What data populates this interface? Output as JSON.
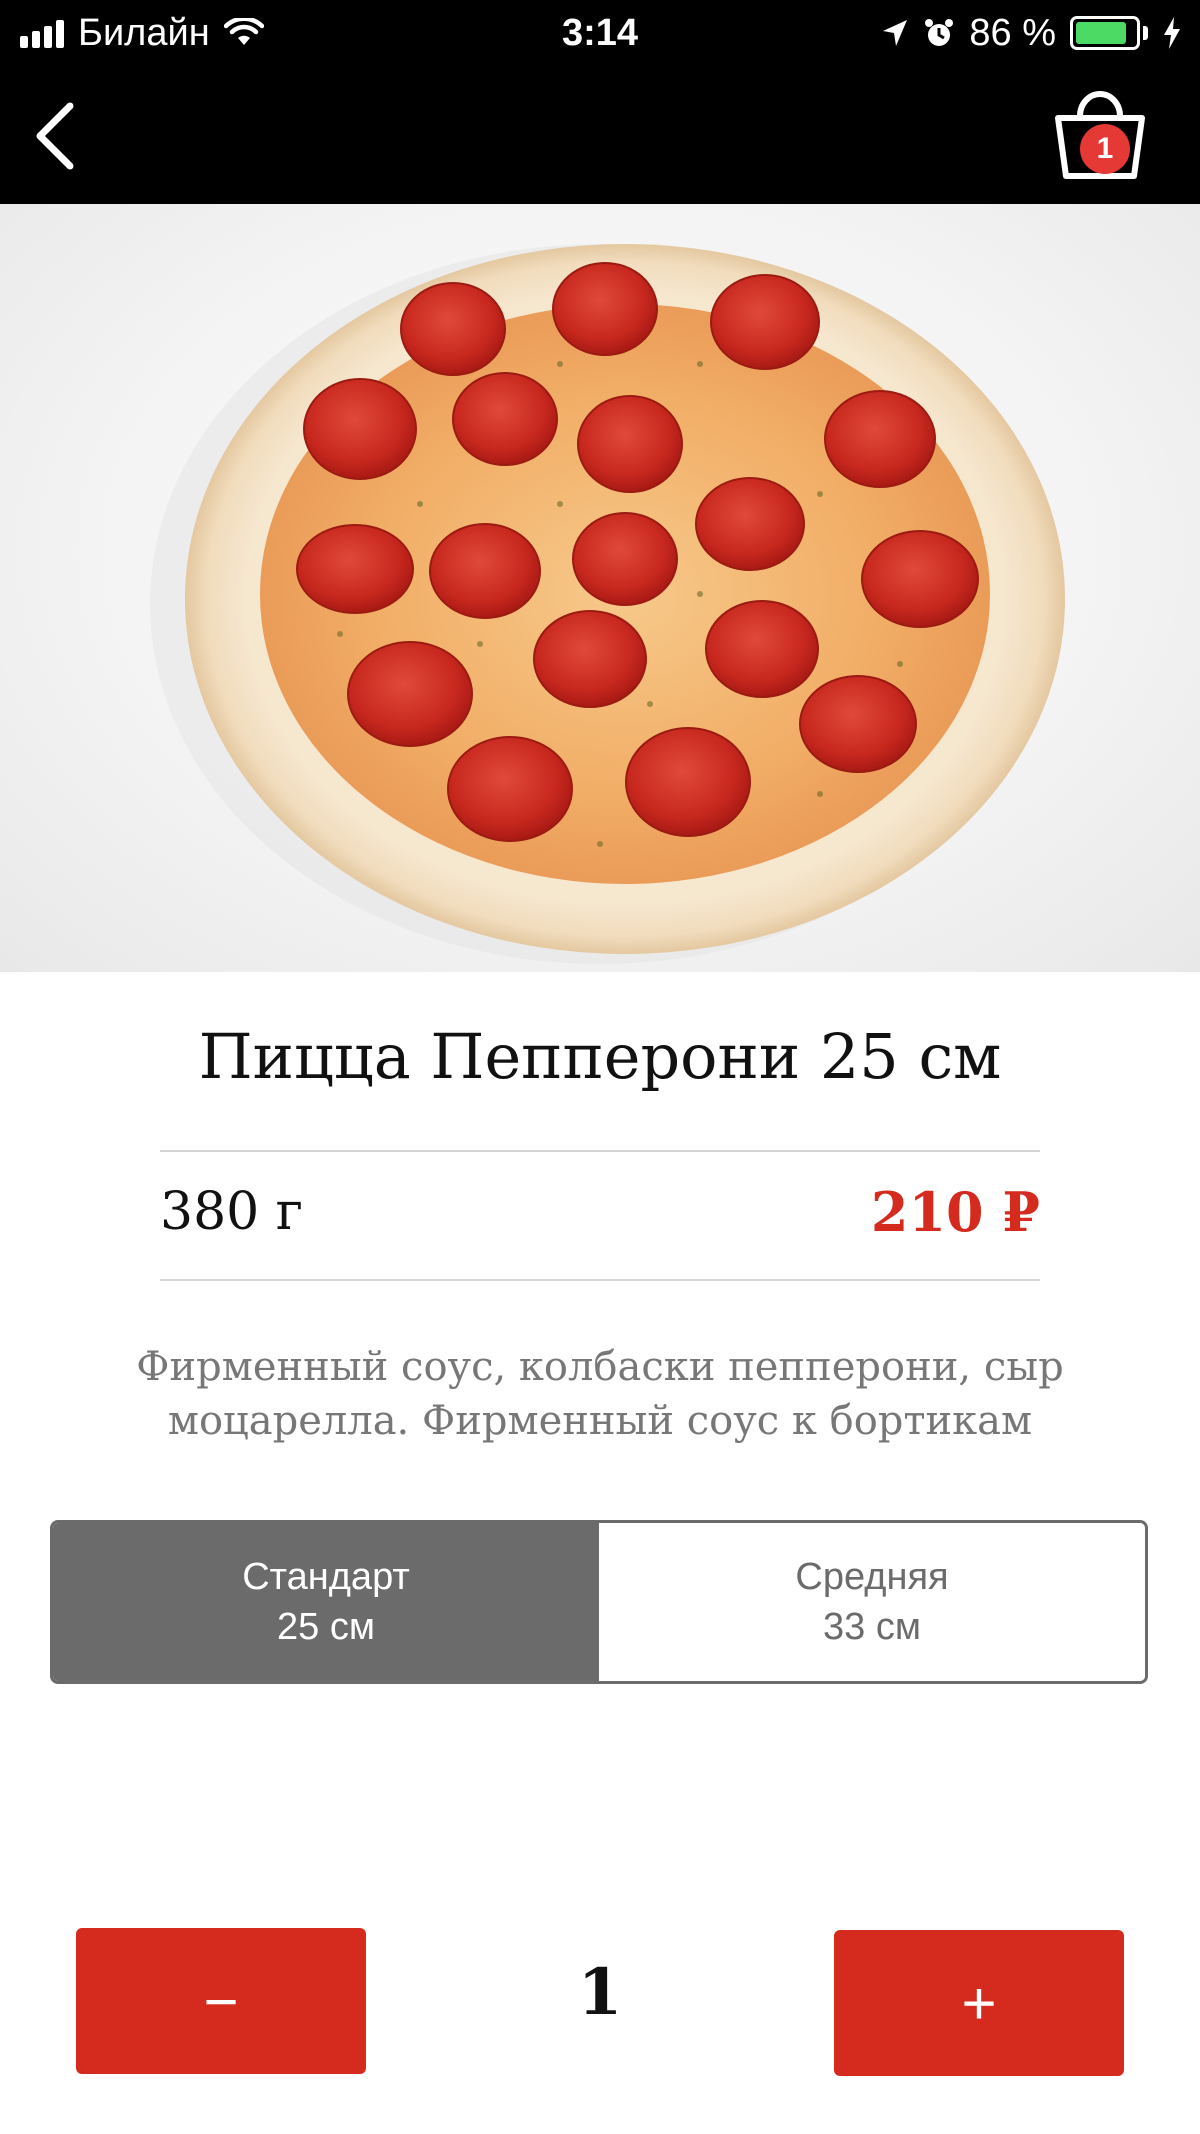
{
  "status_bar": {
    "carrier": "Билайн",
    "time": "3:14",
    "battery": "86 %",
    "battery_level": 0.86
  },
  "nav": {
    "cart_count": "1"
  },
  "product": {
    "title": "Пицца Пепперони 25 см",
    "weight": "380 г",
    "price": "210 ₽",
    "description": "Фирменный соус, колбаски пепперони, сыр моцарелла. Фирменный соус к бортикам"
  },
  "sizes": [
    {
      "name": "Стандарт",
      "size": "25 см",
      "selected": true
    },
    {
      "name": "Средняя",
      "size": "33 см",
      "selected": false
    }
  ],
  "quantity": {
    "minus_label": "−",
    "value": "1",
    "plus_label": "+"
  },
  "colors": {
    "accent": "#d52b1e",
    "selected_segment": "#6b6b6b",
    "battery": "#4cd964"
  }
}
